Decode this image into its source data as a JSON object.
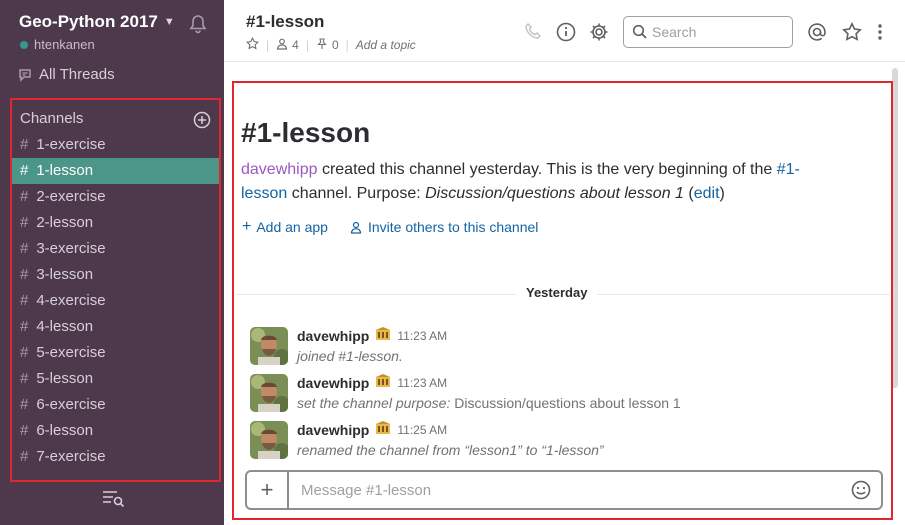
{
  "workspace": {
    "name": "Geo-Python 2017",
    "user": "htenkanen"
  },
  "sidebar": {
    "all_threads": "All Threads",
    "channels_header": "Channels",
    "channels": [
      {
        "hash": "#",
        "name": "1-exercise"
      },
      {
        "hash": "#",
        "name": "1-lesson"
      },
      {
        "hash": "#",
        "name": "2-exercise"
      },
      {
        "hash": "#",
        "name": "2-lesson"
      },
      {
        "hash": "#",
        "name": "3-exercise"
      },
      {
        "hash": "#",
        "name": "3-lesson"
      },
      {
        "hash": "#",
        "name": "4-exercise"
      },
      {
        "hash": "#",
        "name": "4-lesson"
      },
      {
        "hash": "#",
        "name": "5-exercise"
      },
      {
        "hash": "#",
        "name": "5-lesson"
      },
      {
        "hash": "#",
        "name": "6-exercise"
      },
      {
        "hash": "#",
        "name": "6-lesson"
      },
      {
        "hash": "#",
        "name": "7-exercise"
      }
    ],
    "active_channel": "1-lesson",
    "icons": [
      "chevron-down-icon",
      "bell-icon",
      "threads-icon",
      "add-channel-icon",
      "quick-switcher-icon"
    ]
  },
  "header": {
    "channel_title": "#1-lesson",
    "member_count": "4",
    "pinned_count": "0",
    "add_topic": "Add a topic",
    "search_placeholder": "Search",
    "icons": [
      "star-icon",
      "member-icon",
      "pin-icon",
      "phone-icon",
      "info-icon",
      "gear-icon",
      "search-icon",
      "mention-icon",
      "star-icon",
      "more-icon"
    ]
  },
  "intro": {
    "title": "#1-lesson",
    "creator": "davewhipp",
    "created_text": " created this channel yesterday. This is the very beginning of the ",
    "channel_link": "#1-lesson",
    "purpose_label": " channel. Purpose: ",
    "purpose": "Discussion/questions about lesson 1",
    "edit_open": " (",
    "edit_link": "edit",
    "edit_close": ")",
    "add_app": "Add an app",
    "invite": "Invite others to this channel"
  },
  "day_divider": "Yesterday",
  "messages": [
    {
      "author": "davewhipp",
      "time": "11:23 AM",
      "italic": "joined #1-lesson.",
      "plain": ""
    },
    {
      "author": "davewhipp",
      "time": "11:23 AM",
      "italic": "set the channel purpose: ",
      "plain": "Discussion/questions about lesson 1"
    },
    {
      "author": "davewhipp",
      "time": "11:25 AM",
      "italic": "renamed the channel from “lesson1” to “1-lesson”",
      "plain": ""
    }
  ],
  "composer": {
    "placeholder": "Message #1-lesson",
    "plus": "+"
  },
  "colors": {
    "sidebar_bg": "#4d394b",
    "active_channel_bg": "#4c9689",
    "link": "#1264a3",
    "username": "#9d58c2",
    "highlight_box": "#e0262e"
  }
}
